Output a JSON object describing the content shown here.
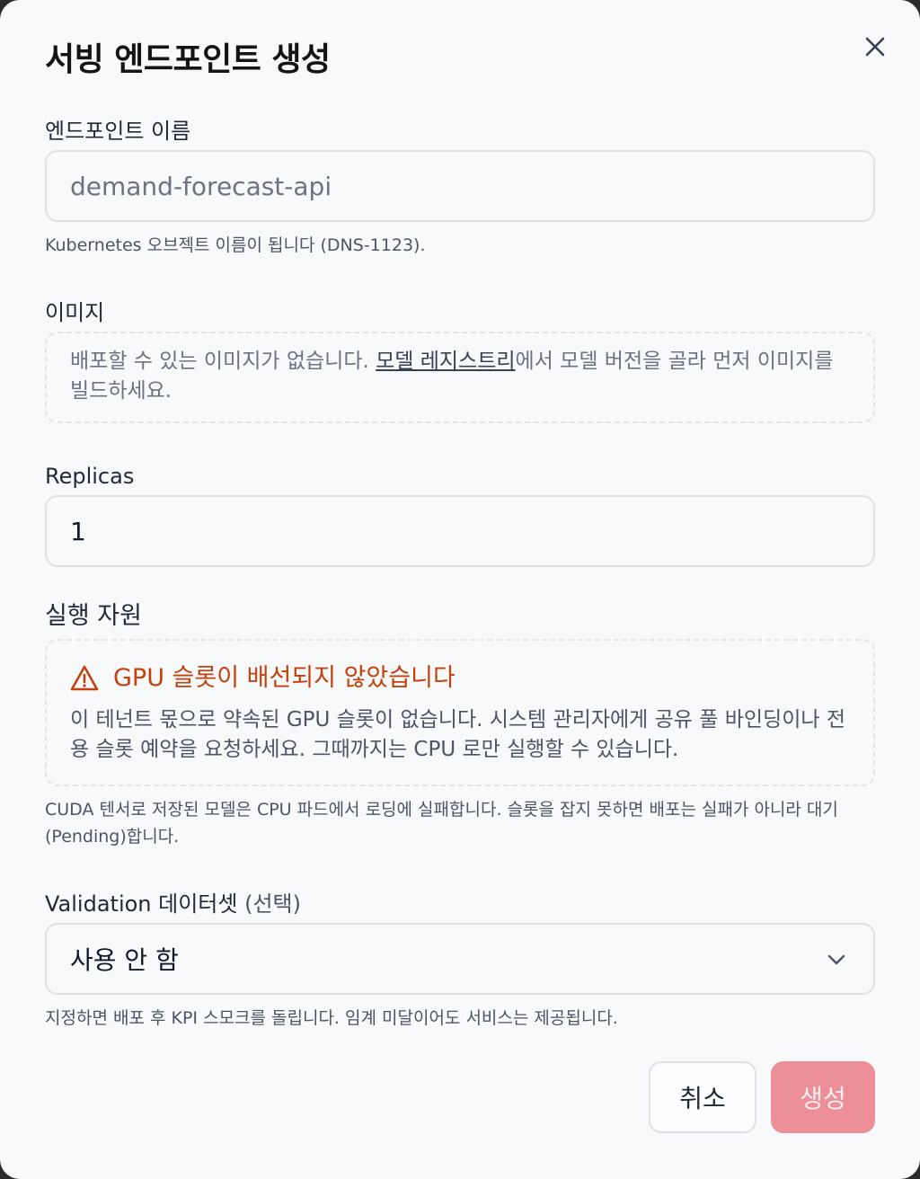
{
  "dialog": {
    "title": "서빙 엔드포인트 생성"
  },
  "endpoint_name": {
    "label": "엔드포인트 이름",
    "value": "demand-forecast-api",
    "hint": "Kubernetes 오브젝트 이름이 됩니다 (DNS-1123)."
  },
  "image": {
    "label": "이미지",
    "empty_prefix": "배포할 수 있는 이미지가 없습니다. ",
    "empty_link": "모델 레지스트리",
    "empty_suffix": "에서 모델 버전을 골라 먼저 이미지를 빌드하세요."
  },
  "replicas": {
    "label": "Replicas",
    "value": "1"
  },
  "resources": {
    "label": "실행 자원",
    "warning_title": "GPU 슬롯이 배선되지 않았습니다",
    "warning_body": "이 테넌트 몫으로 약속된 GPU 슬롯이 없습니다. 시스템 관리자에게 공유 풀 바인딩이나 전용 슬롯 예약을 요청하세요. 그때까지는 CPU 로만 실행할 수 있습니다.",
    "hint": "CUDA 텐서로 저장된 모델은 CPU 파드에서 로딩에 실패합니다. 슬롯을 잡지 못하면 배포는 실패가 아니라 대기(Pending)합니다."
  },
  "validation": {
    "label": "Validation 데이터셋",
    "label_optional": "(선택)",
    "selected": "사용 안 함",
    "hint": "지정하면 배포 후 KPI 스모크를 돌립니다. 임계 미달이어도 서비스는 제공됩니다."
  },
  "actions": {
    "cancel": "취소",
    "create": "생성"
  },
  "colors": {
    "warning": "#c2410c",
    "primary_disabled": "#ec8f99"
  }
}
